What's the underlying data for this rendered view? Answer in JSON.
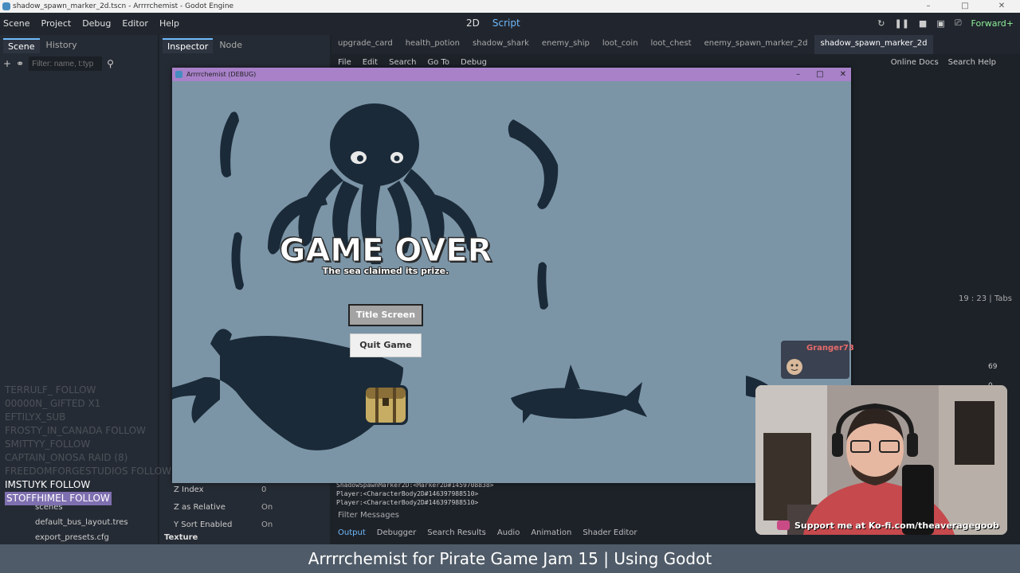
{
  "os_window": {
    "title": "shadow_spawn_marker_2d.tscn - Arrrrchemist - Godot Engine"
  },
  "editor": {
    "menus": [
      "Scene",
      "Project",
      "Debug",
      "Editor",
      "Help"
    ],
    "workspace": {
      "two_d": "2D",
      "script": "Script"
    },
    "renderer": "Forward+",
    "left_dock": {
      "tabs": [
        "Scene",
        "History"
      ],
      "filter_placeholder": "Filter: name, t:typ"
    },
    "inspector": {
      "tabs": [
        "Inspector",
        "Node"
      ],
      "props": [
        {
          "label": "Z Index",
          "value": "0"
        },
        {
          "label": "Z as Relative",
          "value": "On"
        },
        {
          "label": "Y Sort Enabled",
          "value": "On"
        }
      ],
      "section": "Texture"
    },
    "script_tabs": [
      "upgrade_card",
      "health_potion",
      "shadow_shark",
      "enemy_ship",
      "loot_coin",
      "loot_chest",
      "enemy_spawn_marker_2d",
      "shadow_spawn_marker_2d"
    ],
    "script_menu": [
      "File",
      "Edit",
      "Search",
      "Go To",
      "Debug"
    ],
    "script_menu_right": [
      "Online Docs",
      "Search Help"
    ],
    "caret_status": "19 :  23  |  Tabs",
    "output_lines": [
      "ShadowSpawnMarker2D:<Marker2D#1459708838>",
      "Player:<CharacterBody2D#146397988510>",
      "Player:<CharacterBody2D#146397988510>"
    ],
    "filter_messages": "Filter Messages",
    "bottom_tabs": [
      "Output",
      "Debugger",
      "Search Results",
      "Audio",
      "Animation",
      "Shader Editor"
    ],
    "right_counts": [
      "69",
      "0"
    ],
    "files": [
      "scenes",
      "default_bus_layout.tres",
      "export_presets.cfg"
    ]
  },
  "game_window": {
    "title": "Arrrrchemist (DEBUG)",
    "heading": "GAME OVER",
    "subtitle": "The sea claimed its prize.",
    "title_screen_button": "Title Screen",
    "quit_button": "Quit Game"
  },
  "stream": {
    "chat_lines": [
      "TERRULF_ FOLLOW",
      "00000N_ GIFTED X1",
      "EFTILYX_SUB",
      "FROSTY_IN_CANADA  FOLLOW",
      "SMITTYY_FOLLOW",
      "CAPTAIN_ONOSA  RAID (8)",
      "FREEDOMFORGESTUDIOS  FOLLOW",
      "IMSTUYK  FOLLOW",
      "STOFFHIMEL  FOLLOW"
    ],
    "chat_user": "Granger73",
    "kofi": "Support me at Ko-fi.com/theaveragegoob",
    "caption": "Arrrrchemist for Pirate Game Jam 15 | Using Godot"
  },
  "colors": {
    "game_bg": "#7b95a7",
    "silhouette": "#1b2a38",
    "editor_bg": "#1d2229",
    "accent": "#70bafa",
    "debug_titlebar": "#a881c9"
  }
}
